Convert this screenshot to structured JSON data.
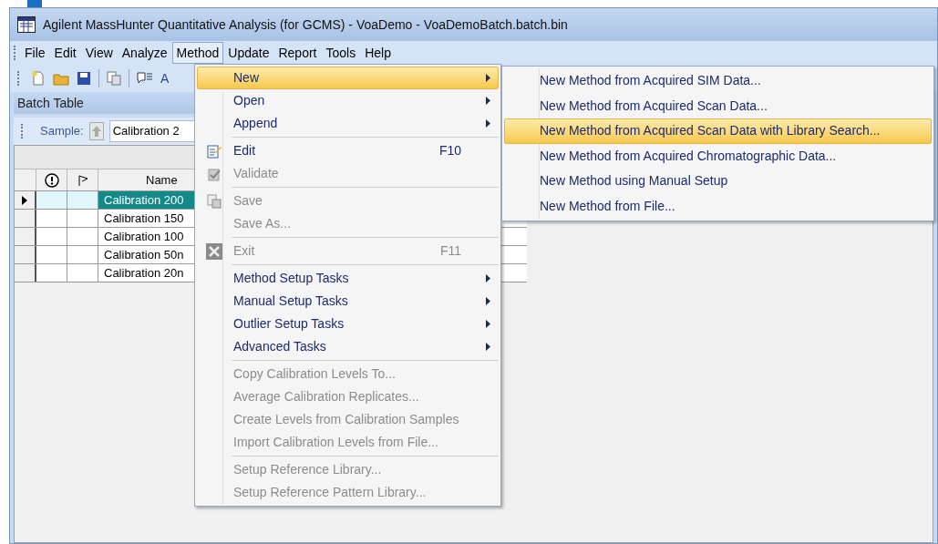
{
  "window": {
    "title": "Agilent MassHunter Quantitative Analysis (for GCMS) - VoaDemo - VoaDemoBatch.batch.bin"
  },
  "menu_bar": [
    {
      "label": "File",
      "selected": false
    },
    {
      "label": "Edit",
      "selected": false
    },
    {
      "label": "View",
      "selected": false
    },
    {
      "label": "Analyze",
      "selected": false
    },
    {
      "label": "Method",
      "selected": true
    },
    {
      "label": "Update",
      "selected": false
    },
    {
      "label": "Report",
      "selected": false
    },
    {
      "label": "Tools",
      "selected": false
    },
    {
      "label": "Help",
      "selected": false
    }
  ],
  "toolbar": {
    "partial_label": "A"
  },
  "panel": {
    "title": "Batch Table",
    "sample_label": "Sample:",
    "sample_value": "Calibration 2"
  },
  "table": {
    "columns": [
      "Name"
    ],
    "rows": [
      {
        "name": "Calibration 200",
        "selected": true
      },
      {
        "name": "Calibration 150",
        "selected": false
      },
      {
        "name": "Calibration 100",
        "selected": false
      },
      {
        "name": "Calibration 50n",
        "selected": false
      },
      {
        "name": "Calibration 20n",
        "selected": false
      }
    ]
  },
  "method_menu": [
    {
      "kind": "item",
      "label": "New",
      "submenu": true,
      "disabled": false,
      "selected": true
    },
    {
      "kind": "item",
      "label": "Open",
      "submenu": true,
      "disabled": false,
      "selected": false
    },
    {
      "kind": "item",
      "label": "Append",
      "submenu": true,
      "disabled": false,
      "selected": false
    },
    {
      "kind": "separator"
    },
    {
      "kind": "item",
      "label": "Edit",
      "shortcut": "F10",
      "disabled": false,
      "selected": false
    },
    {
      "kind": "item",
      "label": "Validate",
      "disabled": true,
      "selected": false
    },
    {
      "kind": "separator"
    },
    {
      "kind": "item",
      "label": "Save",
      "disabled": true,
      "selected": false
    },
    {
      "kind": "item",
      "label": "Save As...",
      "disabled": true,
      "selected": false
    },
    {
      "kind": "separator"
    },
    {
      "kind": "item",
      "label": "Exit",
      "shortcut": "F11",
      "disabled": true,
      "selected": false
    },
    {
      "kind": "separator"
    },
    {
      "kind": "item",
      "label": "Method Setup Tasks",
      "submenu": true,
      "disabled": false,
      "selected": false
    },
    {
      "kind": "item",
      "label": "Manual Setup Tasks",
      "submenu": true,
      "disabled": false,
      "selected": false
    },
    {
      "kind": "item",
      "label": "Outlier Setup Tasks",
      "submenu": true,
      "disabled": false,
      "selected": false
    },
    {
      "kind": "item",
      "label": "Advanced Tasks",
      "submenu": true,
      "disabled": false,
      "selected": false
    },
    {
      "kind": "separator"
    },
    {
      "kind": "item",
      "label": "Copy Calibration Levels To...",
      "disabled": true,
      "selected": false
    },
    {
      "kind": "item",
      "label": "Average Calibration Replicates...",
      "disabled": true,
      "selected": false
    },
    {
      "kind": "item",
      "label": "Create Levels from Calibration Samples",
      "disabled": true,
      "selected": false
    },
    {
      "kind": "item",
      "label": "Import Calibration Levels from File...",
      "disabled": true,
      "selected": false
    },
    {
      "kind": "separator"
    },
    {
      "kind": "item",
      "label": "Setup Reference Library...",
      "disabled": true,
      "selected": false
    },
    {
      "kind": "item",
      "label": "Setup Reference Pattern Library...",
      "disabled": true,
      "selected": false
    }
  ],
  "new_submenu": [
    {
      "label": "New Method from Acquired SIM Data...",
      "selected": false
    },
    {
      "label": "New Method from Acquired Scan Data...",
      "selected": false
    },
    {
      "label": "New Method from Acquired Scan Data with Library Search...",
      "selected": true
    },
    {
      "label": "New Method from Acquired Chromatographic Data...",
      "selected": false
    },
    {
      "label": "New Method using Manual Setup",
      "selected": false
    },
    {
      "label": "New Method from File...",
      "selected": false
    }
  ]
}
